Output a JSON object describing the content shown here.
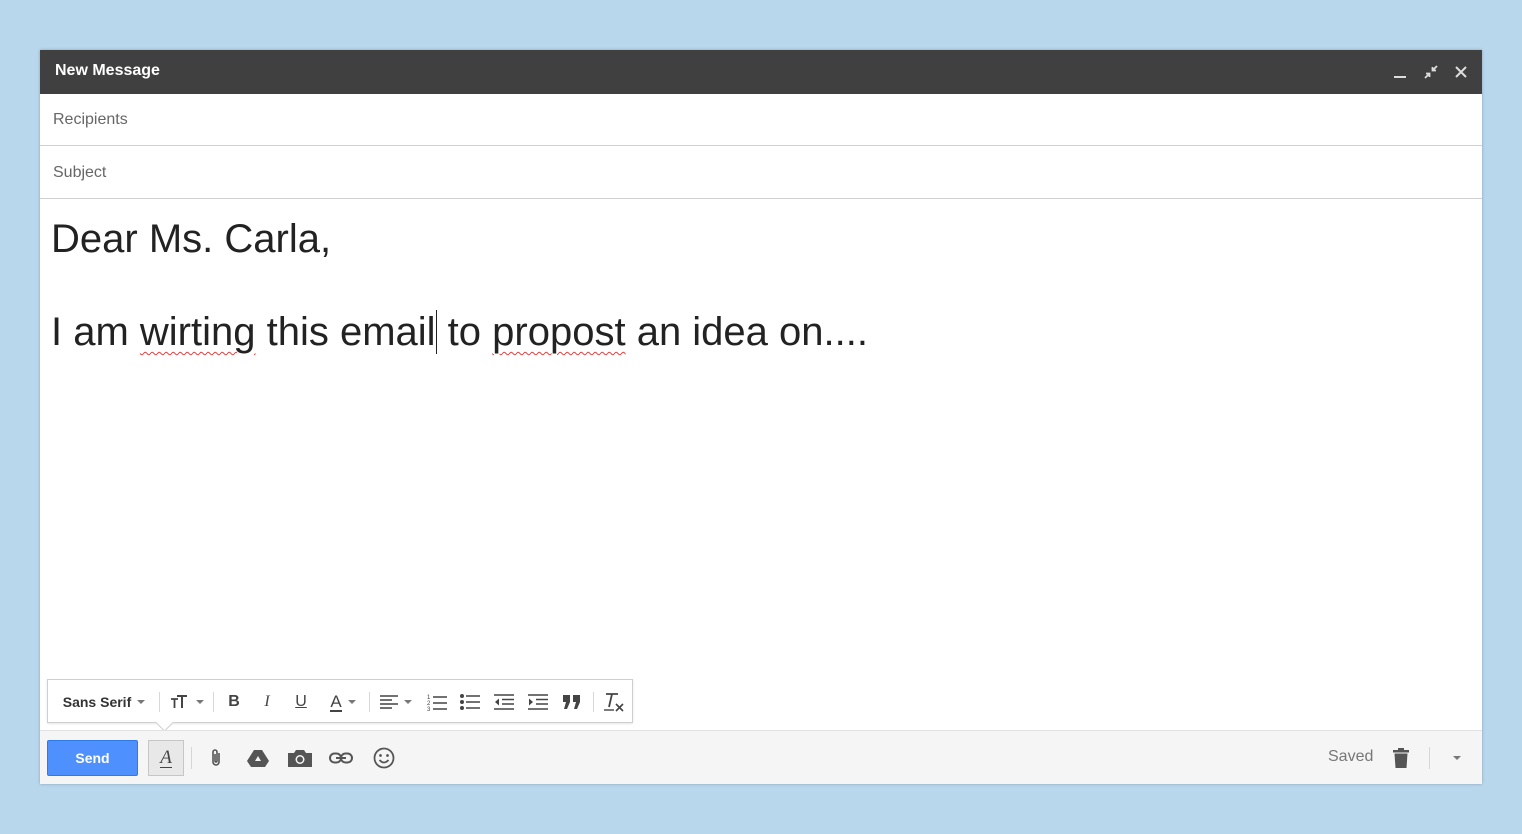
{
  "window": {
    "title": "New Message"
  },
  "fields": {
    "recipients_placeholder": "Recipients",
    "recipients_value": "",
    "subject_placeholder": "Subject",
    "subject_value": ""
  },
  "body": {
    "line1": "Dear Ms. Carla,",
    "line2_parts": [
      "I am ",
      "wirting",
      " this email",
      " to ",
      "propost",
      " an idea on...."
    ],
    "misspelled": [
      "wirting",
      "propost"
    ]
  },
  "format_toolbar": {
    "font_label": "Sans Serif",
    "icons": [
      "font-size-icon",
      "bold-icon",
      "italic-icon",
      "underline-icon",
      "text-color-icon",
      "align-icon",
      "numbered-list-icon",
      "bulleted-list-icon",
      "indent-less-icon",
      "indent-more-icon",
      "quote-icon",
      "remove-formatting-icon"
    ],
    "bold_glyph": "B",
    "italic_glyph": "I",
    "underline_glyph": "U",
    "text_color_glyph": "A",
    "format_toggle_glyph": "A"
  },
  "bottom_bar": {
    "send_label": "Send",
    "saved_label": "Saved",
    "icons": [
      "formatting-options-icon",
      "attach-icon",
      "drive-icon",
      "photo-icon",
      "link-icon",
      "emoji-icon",
      "trash-icon",
      "more-options-icon"
    ]
  },
  "colors": {
    "background": "#b9d7ec",
    "titlebar": "#404040",
    "send_button": "#4d90fe",
    "spellcheck": "#e04040"
  }
}
